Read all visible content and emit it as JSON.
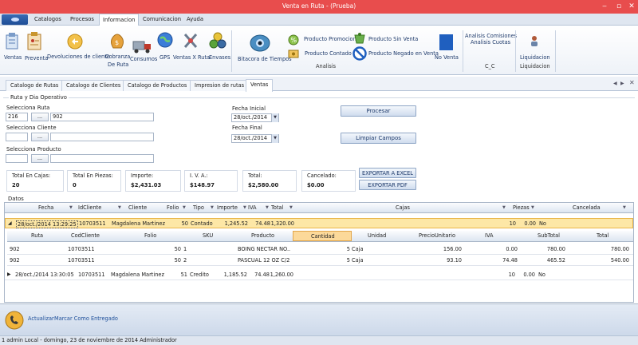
{
  "window": {
    "title": "Venta en Ruta - (Prueba)"
  },
  "menu": [
    "Catalogos",
    "Procesos",
    "Informacion",
    "Comunicacion",
    "Ayuda"
  ],
  "ribbon": {
    "ventas": "Ventas",
    "preventa": "Preventa",
    "devoluciones": "Devoluciones de cliente",
    "cobranza_1": "Cobranza",
    "cobranza_2": "De Ruta",
    "consumos": "Consumos",
    "gps": "GPS",
    "ventas_ruta": "Ventas X Ruta",
    "envases": "Envases",
    "bitacora": "Bitacora de Tiempos",
    "prod_promocion": "Producto Promocion",
    "prod_contado": "Producto Contado",
    "prod_sin_venta": "Producto Sin Venta",
    "prod_negado": "Producto Negado en Venta",
    "no_venta": "No Venta",
    "analisis_comisiones": "Analisis Comisiones",
    "analisis_cuotas": "Analisis Cuotas",
    "liquidacion": "Liquidacion",
    "group_analisis": "Analisis",
    "group_cc": "C_C",
    "group_liquidacion": "Liquidacion"
  },
  "tabs": [
    "Catalogo de Rutas",
    "Catalogo de Clientes",
    "Catalogo de Productos",
    "Impresion de rutas",
    "Ventas"
  ],
  "form": {
    "section": "Ruta y Dia Operativo",
    "ruta_label": "Selecciona Ruta",
    "ruta_code": "216",
    "ruta_name": "902",
    "cliente_label": "Selecciona Cliente",
    "producto_label": "Selecciona Producto",
    "fecha_inicial_label": "Fecha Inicial",
    "fecha_inicial": "28/oct./2014",
    "fecha_final_label": "Fecha Final",
    "fecha_final": "28/oct./2014",
    "btn_dots": "...",
    "btn_procesar": "Procesar",
    "btn_limpiar": "Limpiar Campos"
  },
  "totals": {
    "cajas_label": "Total En Cajas:",
    "cajas": "20",
    "piezas_label": "Total En Piezas:",
    "piezas": "0",
    "importe_label": "Importe:",
    "importe": "$2,431.03",
    "iva_label": "I. V. A.:",
    "iva": "$148.97",
    "total_label": "Total:",
    "total": "$2,580.00",
    "cancelado_label": "Cancelado:",
    "cancelado": "$0.00",
    "btn_excel": "EXPORTAR A EXCEL",
    "btn_pdf": "EXPORTAR PDF"
  },
  "datos_label": "Datos",
  "grid": {
    "headers": [
      "Fecha",
      "IdCliente",
      "Cliente",
      "Folio",
      "Tipo",
      "Importe",
      "IVA",
      "Total",
      "Cajas",
      "Piezas",
      "Cancelada"
    ],
    "rows": [
      {
        "fecha": "28/oct./2014 13:29:25",
        "idcliente": "10703511",
        "cliente": "Magdalena Martinez",
        "folio": "50",
        "tipo": "Contado",
        "importe": "1,245.52",
        "iva": "74.48",
        "total": "1,320.00",
        "cajas": "10",
        "piezas": "0.00",
        "cancelada": "No"
      },
      {
        "fecha": "28/oct./2014 13:30:05",
        "idcliente": "10703511",
        "cliente": "Magdalena Martinez",
        "folio": "51",
        "tipo": "Credito",
        "importe": "1,185.52",
        "iva": "74.48",
        "total": "1,260.00",
        "cajas": "10",
        "piezas": "0.00",
        "cancelada": "No"
      }
    ]
  },
  "detail": {
    "headers": [
      "Ruta",
      "CodCliente",
      "Folio",
      "SKU",
      "Producto",
      "Cantidad",
      "Unidad",
      "PrecioUnitario",
      "IVA",
      "SubTotal",
      "Total"
    ],
    "rows": [
      {
        "ruta": "902",
        "codcliente": "10703511",
        "folio": "50",
        "sku": "1",
        "producto": "BOING NECTAR NO...",
        "cantidad": "5",
        "unidad": "Caja",
        "precio": "156.00",
        "iva": "0.00",
        "subtotal": "780.00",
        "total": "780.00"
      },
      {
        "ruta": "902",
        "codcliente": "10703511",
        "folio": "50",
        "sku": "2",
        "producto": "PASCUAL 12 OZ C/2...",
        "cantidad": "5",
        "unidad": "Caja",
        "precio": "93.10",
        "iva": "74.48",
        "subtotal": "465.52",
        "total": "540.00"
      }
    ]
  },
  "bottom": {
    "actualizar": "Actualizar",
    "marcar": "Marcar Como Entregado"
  },
  "status": "1  admin  Local -   domingo, 23 de noviembre de 2014  Administrador"
}
